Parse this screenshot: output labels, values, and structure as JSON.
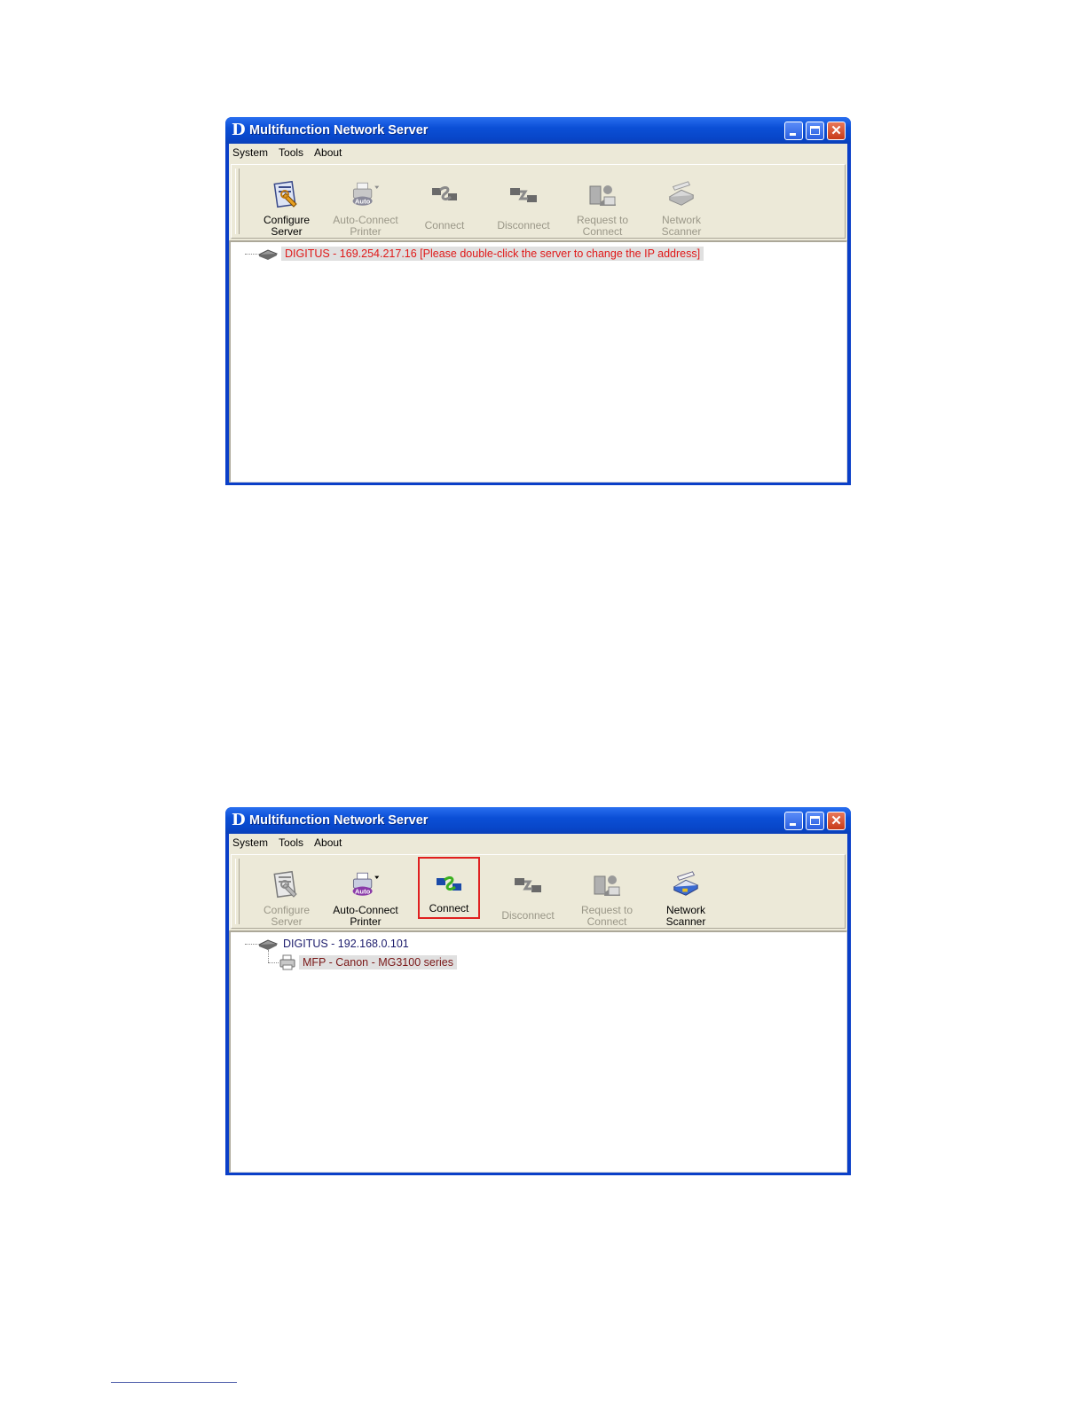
{
  "window1": {
    "title": "Multifunction Network Server",
    "menu": [
      "System",
      "Tools",
      "About"
    ],
    "toolbar": [
      {
        "line1": "Configure",
        "line2": "Server",
        "enabled": true,
        "icon": "configure-server-icon"
      },
      {
        "line1": "Auto-Connect",
        "line2": "Printer",
        "enabled": false,
        "icon": "auto-connect-printer-icon",
        "badge": "Auto"
      },
      {
        "line1": "Connect",
        "line2": "",
        "enabled": false,
        "icon": "connect-icon"
      },
      {
        "line1": "Disconnect",
        "line2": "",
        "enabled": false,
        "icon": "disconnect-icon"
      },
      {
        "line1": "Request to",
        "line2": "Connect",
        "enabled": false,
        "icon": "request-to-connect-icon"
      },
      {
        "line1": "Network",
        "line2": "Scanner",
        "enabled": false,
        "icon": "network-scanner-icon"
      }
    ],
    "tree": {
      "server": "DIGITUS - 169.254.217.16 [Please double-click the server to change the IP address]"
    }
  },
  "window2": {
    "title": "Multifunction Network Server",
    "menu": [
      "System",
      "Tools",
      "About"
    ],
    "toolbar": [
      {
        "line1": "Configure",
        "line2": "Server",
        "enabled": false,
        "icon": "configure-server-icon"
      },
      {
        "line1": "Auto-Connect",
        "line2": "Printer",
        "enabled": true,
        "icon": "auto-connect-printer-icon",
        "badge": "Auto"
      },
      {
        "line1": "Connect",
        "line2": "",
        "enabled": true,
        "icon": "connect-icon",
        "highlighted": true
      },
      {
        "line1": "Disconnect",
        "line2": "",
        "enabled": false,
        "icon": "disconnect-icon"
      },
      {
        "line1": "Request to",
        "line2": "Connect",
        "enabled": false,
        "icon": "request-to-connect-icon"
      },
      {
        "line1": "Network",
        "line2": "Scanner",
        "enabled": true,
        "icon": "network-scanner-icon"
      }
    ],
    "tree": {
      "server": "DIGITUS - 192.168.0.101",
      "device": "MFP - Canon - MG3100 series"
    }
  },
  "colors": {
    "titlebar": "#0b4fd6",
    "chrome": "#ece9d8",
    "error_text": "#e01818",
    "highlight_border": "#e02020"
  }
}
